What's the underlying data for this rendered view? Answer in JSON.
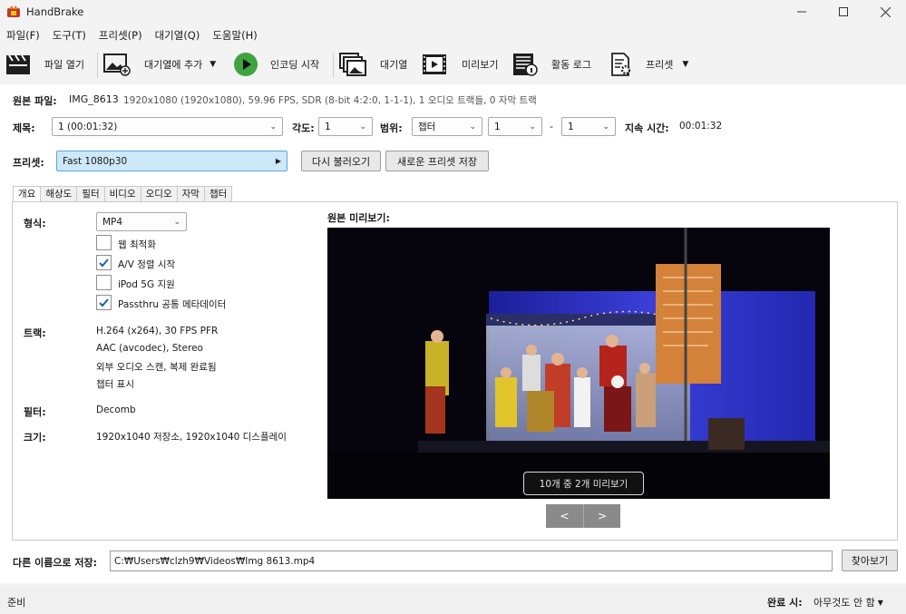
{
  "window": {
    "title": "HandBrake"
  },
  "menu": [
    "파일(F)",
    "도구(T)",
    "프리셋(P)",
    "대기열(Q)",
    "도움말(H)"
  ],
  "toolbar": {
    "open": "파일 열기",
    "add_queue": "대기열에 추가",
    "start": "인코딩 시작",
    "queue": "대기열",
    "preview": "미리보기",
    "activity": "활동 로그",
    "presets": "프리셋"
  },
  "source": {
    "label": "원본 파일:",
    "name": "IMG_8613",
    "info": "1920x1080 (1920x1080), 59.96 FPS, SDR (8-bit 4:2:0, 1-1-1), 1 오디오 트랙들, 0 자막 트랙"
  },
  "title_row": {
    "title_label": "제목:",
    "title_value": "1  (00:01:32)",
    "angle_label": "각도:",
    "angle_value": "1",
    "range_label": "범위:",
    "range_type": "챕터",
    "range_start": "1",
    "range_sep": "-",
    "range_end": "1",
    "duration_label": "지속 시간:",
    "duration_value": "00:01:32"
  },
  "preset_row": {
    "label": "프리셋:",
    "value": "Fast 1080p30",
    "reload": "다시 불러오기",
    "save_new": "새로운 프리셋 저장"
  },
  "tabs": [
    "개요",
    "해상도",
    "필터",
    "비디오",
    "오디오",
    "자막",
    "챕터"
  ],
  "summary": {
    "format_label": "형식:",
    "format_value": "MP4",
    "checks": [
      {
        "label": "웹 최적화",
        "checked": false
      },
      {
        "label": "A/V 정렬 시작",
        "checked": true
      },
      {
        "label": "iPod 5G 지원",
        "checked": false
      },
      {
        "label": "Passthru 공통 메타데이터",
        "checked": true
      }
    ],
    "tracks_label": "트랙:",
    "tracks": [
      "H.264 (x264), 30 FPS PFR",
      "AAC (avcodec), Stereo",
      "외부 오디오 스캔, 복제 완료됨",
      "챕터 표시"
    ],
    "filters_label": "필터:",
    "filters_value": "Decomb",
    "size_label": "크기:",
    "size_value": "1920x1040 저장소, 1920x1040 디스플레이"
  },
  "preview": {
    "label": "원본 미리보기:",
    "overlay": "10개 중 2개 미리보기",
    "prev": "<",
    "next": ">"
  },
  "save_as": {
    "label": "다른 이름으로 저장:",
    "path": "C:₩Users₩clzh9₩Videos₩Img 8613.mp4",
    "browse": "찾아보기"
  },
  "status": {
    "state": "준비",
    "when_done_label": "완료 시:",
    "when_done_value": "아무것도 안 함"
  }
}
